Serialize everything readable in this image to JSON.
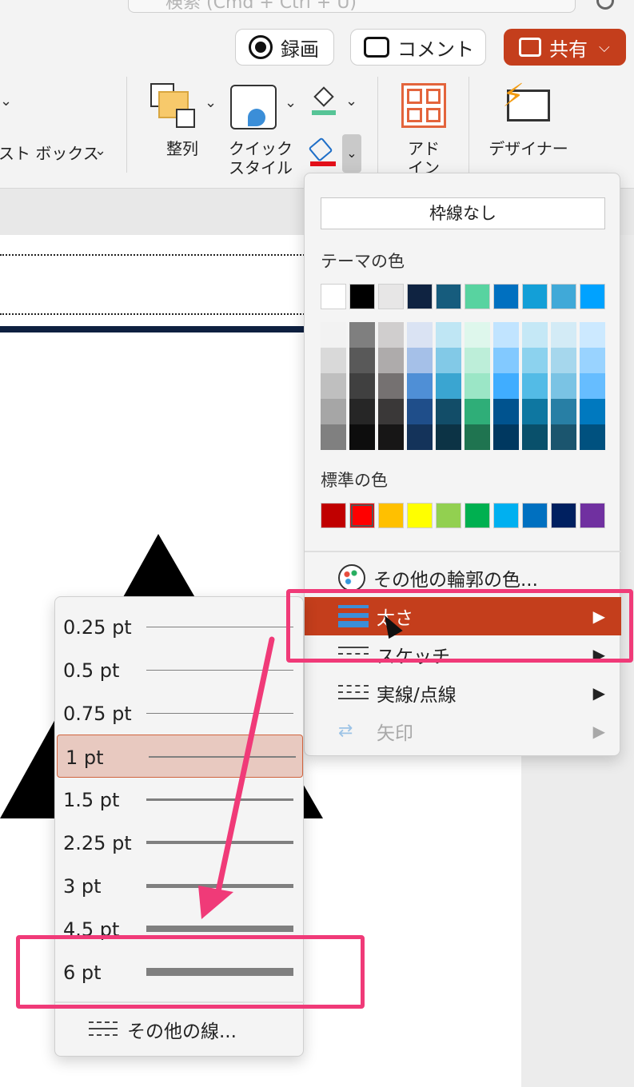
{
  "search": {
    "placeholder": "検索 (Cmd + Ctrl + U)"
  },
  "toolbar": {
    "record_label": "録画",
    "comment_label": "コメント",
    "share_label": "共有"
  },
  "ribbon": {
    "textbox_label": "スト ボックス",
    "arrange_label": "整列",
    "quick_style_label": "クイック\nスタイル",
    "quick_style_line1": "クイック",
    "quick_style_line2": "スタイル",
    "addins_line1": "アド",
    "addins_line2": "イン",
    "designer_label": "デザイナー"
  },
  "color_menu": {
    "no_outline": "枠線なし",
    "theme_colors_title": "テーマの色",
    "standard_colors_title": "標準の色",
    "theme_colors": [
      "#ffffff",
      "#000000",
      "#e7e6e6",
      "#0f2341",
      "#165c7d",
      "#58d3a0",
      "#0070c0",
      "#139fd7",
      "#40a9d8",
      "#00a2ff"
    ],
    "theme_tints": [
      [
        "#f2f2f2",
        "#d9d9d9",
        "#bfbfbf",
        "#a6a6a6",
        "#808080"
      ],
      [
        "#7f7f7f",
        "#595959",
        "#404040",
        "#262626",
        "#0d0d0d"
      ],
      [
        "#d0cece",
        "#aeabab",
        "#757171",
        "#3a3838",
        "#171616"
      ],
      [
        "#dae3f3",
        "#a5c0e8",
        "#4f8fd6",
        "#1f4e8a",
        "#14335a"
      ],
      [
        "#bfe6f4",
        "#82c9e7",
        "#3aa5d1",
        "#124d68",
        "#0c3345"
      ],
      [
        "#def7ec",
        "#bdeed9",
        "#9be6c6",
        "#2fae78",
        "#1f7450"
      ],
      [
        "#c1e4ff",
        "#82c9ff",
        "#40adff",
        "#00538f",
        "#003860"
      ],
      [
        "#c5e8f6",
        "#8cd2ee",
        "#53bbe6",
        "#0e77a1",
        "#09506b"
      ],
      [
        "#d3ebf6",
        "#a6d7ed",
        "#7ac3e4",
        "#287fa5",
        "#1b556e"
      ],
      [
        "#cce9ff",
        "#99d3ff",
        "#66bdff",
        "#0079bf",
        "#00517f"
      ]
    ],
    "standard_colors": [
      "#c00000",
      "#ff0000",
      "#ffc000",
      "#ffff00",
      "#92d050",
      "#00b050",
      "#00b0f0",
      "#0070c0",
      "#002060",
      "#7030a0"
    ],
    "selected_standard_index": 1,
    "items": {
      "more_colors": "その他の輪郭の色...",
      "weight": "太さ",
      "sketch": "スケッチ",
      "dash": "実線/点線",
      "arrows": "矢印"
    },
    "highlight_color": "#c43e1c"
  },
  "weight_menu": {
    "items": [
      "0.25 pt",
      "0.5 pt",
      "0.75 pt",
      "1 pt",
      "1.5 pt",
      "2.25 pt",
      "3 pt",
      "4.5 pt",
      "6 pt"
    ],
    "selected": "1 pt",
    "more_lines": "その他の線..."
  },
  "annotation": {
    "color": "#f03a78"
  }
}
